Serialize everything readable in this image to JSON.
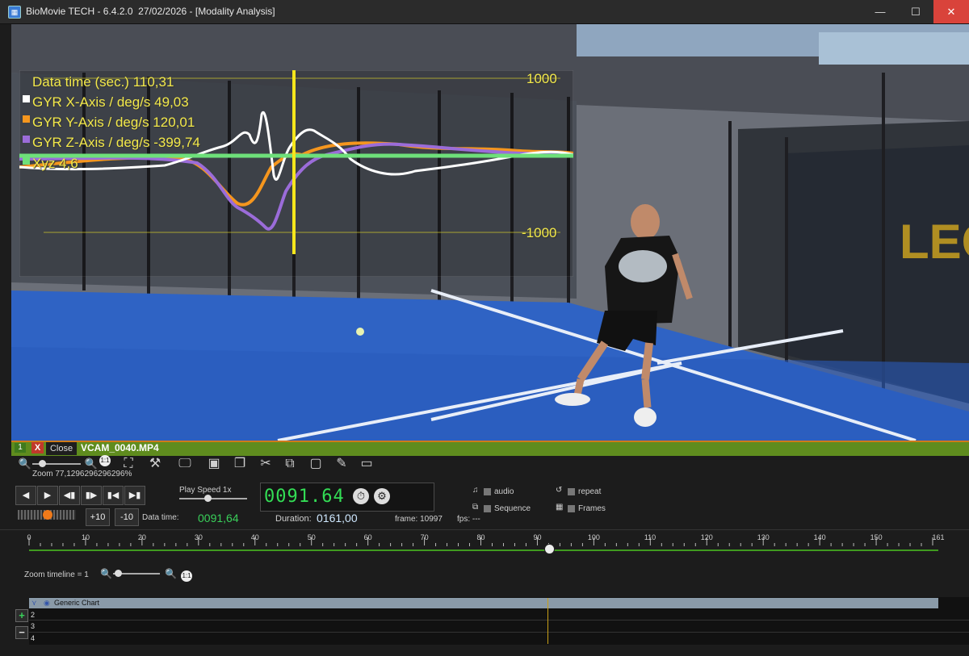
{
  "window": {
    "title": "BioMovie TECH - 6.4.2.0  27/02/2026 - [Modality Analysis]",
    "minimize": "—",
    "maximize": "☐",
    "close": "✕"
  },
  "overlay": {
    "data_time": "Data time (sec.) 110,31",
    "gyr_x": "GYR X-Axis / deg/s 49,03",
    "gyr_y": "GYR Y-Axis / deg/s 120,01",
    "gyr_z": "GYR Z-Axis / deg/s -399,74",
    "xyz": "Xyz 4,6",
    "top_value": "1000",
    "bottom_value": "-1000",
    "colors": {
      "x": "#ffffff",
      "y": "#f5961e",
      "z": "#9b6cd9",
      "xyz": "#6ee07a",
      "cursor": "#f5e61c"
    }
  },
  "video_tab": {
    "number": "1",
    "x_label": "X",
    "close_label": "Close",
    "filename": "VCAM_0040.MP4"
  },
  "toolbar": {
    "zoom_label": "Zoom 77,1296296296296%",
    "icons": [
      "zoom-out-icon",
      "zoom-slider",
      "one-to-one-icon",
      "fit-icon",
      "tools-icon",
      "monitor-icon",
      "save-frame-icon",
      "save-all-icon",
      "scissors-icon",
      "copy-icon",
      "snapshot-icon",
      "notes-icon",
      "export-icon"
    ]
  },
  "transport": {
    "play_speed_label": "Play Speed 1x",
    "plus10": "+10",
    "minus10": "-10",
    "data_time_label": "Data time:",
    "data_time_value": "0091,64",
    "counter": "0091.64",
    "duration_label": "Duration:",
    "duration_value": "0161,00",
    "frame_label": "frame: 10997",
    "fps_label": "fps: ---",
    "audio": "audio",
    "sequence": "Sequence",
    "repeat": "repeat",
    "frames": "Frames"
  },
  "timeline": {
    "ticks": [
      "0",
      "10",
      "20",
      "30",
      "40",
      "50",
      "60",
      "70",
      "80",
      "90",
      "100",
      "110",
      "120",
      "130",
      "140",
      "150",
      "161"
    ],
    "zoom_label": "Zoom timeline = 1",
    "cursor_value": 91.64,
    "max_value": 161
  },
  "tracks": {
    "header": "Generic Chart",
    "rows": [
      "2",
      "3",
      "4"
    ],
    "add": "+",
    "remove": "−"
  }
}
